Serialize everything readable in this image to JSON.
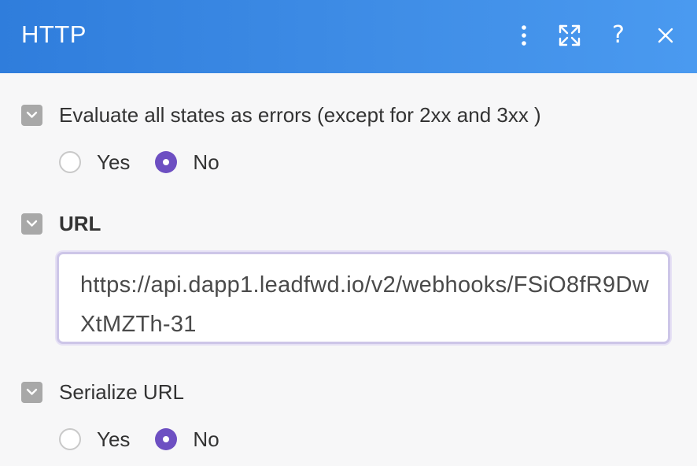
{
  "header": {
    "title": "HTTP",
    "icons": [
      "more-vertical-icon",
      "expand-icon",
      "help-icon",
      "close-icon"
    ],
    "help_glyph": "?"
  },
  "sections": [
    {
      "label": "Evaluate all states as errors (except for 2xx and 3xx )",
      "options": [
        "Yes",
        "No"
      ],
      "selected": "No"
    },
    {
      "label": "URL",
      "value": "https://api.dapp1.leadfwd.io/v2/webhooks/FSiO8fR9DwXtMZTh-31"
    },
    {
      "label": "Serialize URL",
      "options": [
        "Yes",
        "No"
      ],
      "selected": "No"
    }
  ],
  "colors": {
    "header_gradient_start": "#2f7ddc",
    "header_gradient_end": "#4a9af0",
    "radio_selected": "#6d4fc2",
    "chevron_bg": "#a8a8a8",
    "input_border": "#cdc6e8"
  }
}
